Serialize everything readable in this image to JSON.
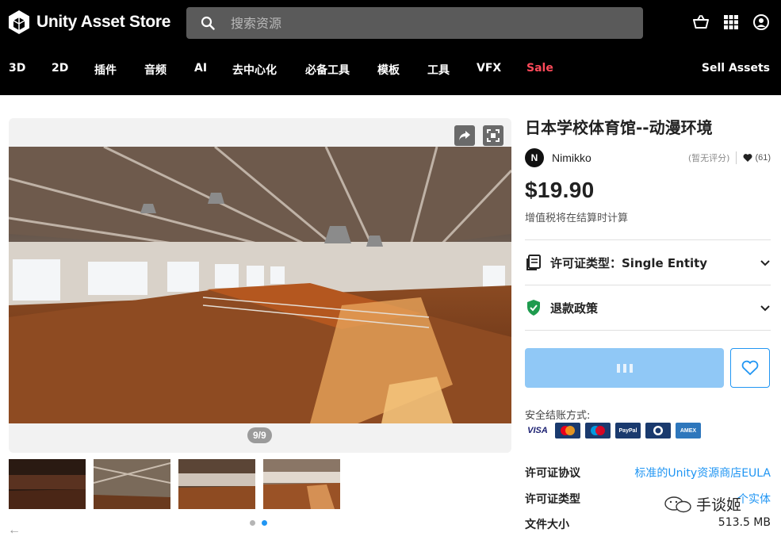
{
  "header": {
    "logo_text": "Unity Asset Store",
    "search_placeholder": "搜索资源",
    "icons": [
      "search-icon",
      "cart-icon",
      "grid-icon",
      "user-icon"
    ]
  },
  "nav": {
    "items": [
      "3D",
      "2D",
      "插件",
      "音频",
      "AI",
      "去中心化",
      "必备工具",
      "模板",
      "工具",
      "VFX",
      "Sale"
    ],
    "sell": "Sell Assets",
    "sale_color": "#ff4a5a"
  },
  "gallery": {
    "pager": "9/9",
    "share_icon": "share-icon",
    "fullscreen_icon": "fullscreen-icon",
    "thumbnail_count": 4,
    "dots": 2,
    "active_dot": 2
  },
  "product": {
    "title": "日本学校体育馆--动漫环境",
    "publisher_initial": "N",
    "publisher": "Nimikko",
    "rating_text": "(暂无评分)",
    "favorites": "(61)",
    "price": "$19.90",
    "vat_note": "增值税将在结算时计算",
    "license_type_label": "许可证类型：Single Entity",
    "refund_label": "退款政策",
    "payment_label": "安全结账方式:",
    "payment_cards": [
      "VISA",
      "mastercard",
      "maestro",
      "PayPal",
      "Diners",
      "AMEX"
    ],
    "details": [
      {
        "key": "许可证协议",
        "value": "标准的Unity资源商店EULA"
      },
      {
        "key": "许可证类型",
        "value": "个实体"
      },
      {
        "key": "文件大小",
        "value": "513.5 MB"
      }
    ]
  },
  "watermark": "手谈姬",
  "colors": {
    "accent": "#2196f3",
    "add_button_disabled": "#90c8f6",
    "topbar": "#000000"
  }
}
